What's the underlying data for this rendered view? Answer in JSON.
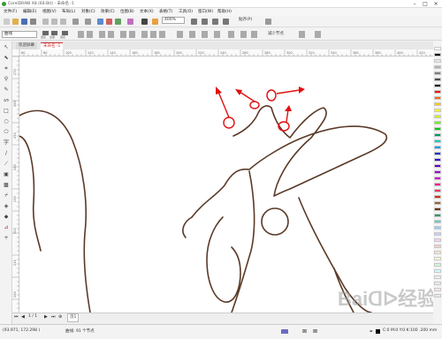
{
  "window": {
    "title": "CorelDRAW X8 (64-Bit) - 未命名 -1",
    "minimize": "–",
    "maximize": "□",
    "close": "×"
  },
  "menu": [
    "文件(F)",
    "编辑(E)",
    "视图(V)",
    "布局(L)",
    "对象(C)",
    "效果(C)",
    "位图(B)",
    "文本(X)",
    "表格(T)",
    "工具(O)",
    "窗口(W)",
    "帮助(H)"
  ],
  "toolbar": {
    "zoom_value": "400%",
    "snap_label": "贴齐(P)"
  },
  "property_bar": {
    "object_type": "曲线",
    "smoothing_label": "减少节点",
    "button_labels": [
      "选定",
      "全部",
      "选定"
    ]
  },
  "tabs": [
    "欢迎屏幕",
    "未命名 -1"
  ],
  "rulers": {
    "top": [
      "60",
      "80",
      "100",
      "120",
      "140",
      "160",
      "180",
      "200",
      "220",
      "240",
      "260",
      "280",
      "300",
      "320",
      "340",
      "360",
      "380",
      "400",
      "420",
      "440"
    ],
    "left": [
      "270",
      "260",
      "250",
      "240",
      "230",
      "220",
      "210",
      "200"
    ]
  },
  "page_nav": {
    "page_count": "1 / 1",
    "page_tab": "页1"
  },
  "status": {
    "coords": "(93.971, 172.298 )",
    "selection": "曲线: 91 个节点",
    "fill": "C:0 M:0 Y:0 K:100 .200 mm"
  },
  "palette_colors": [
    "#ffffff",
    "#000000",
    "#e6e6e6",
    "#b3b3b3",
    "#808080",
    "#4d4d4d",
    "#1c1c1c",
    "#ff0000",
    "#ff6600",
    "#ffcc00",
    "#ffff00",
    "#ccff00",
    "#66ff00",
    "#00cc00",
    "#009966",
    "#00cccc",
    "#0099ff",
    "#0033cc",
    "#3300cc",
    "#6600cc",
    "#9900cc",
    "#cc00cc",
    "#ff0099",
    "#ff3366",
    "#cc3300",
    "#996633",
    "#663300",
    "#339966",
    "#66cccc",
    "#99ccff",
    "#ccccff",
    "#ffccff",
    "#ffcccc",
    "#ffe5cc",
    "#ffffcc",
    "#ccffcc",
    "#ccffff",
    "#e6f2ff",
    "#f2e6ff",
    "#fce4ec",
    "#e8e8e8"
  ],
  "colors": {
    "outline": "#5a3a28",
    "annotation": "#e01010"
  }
}
